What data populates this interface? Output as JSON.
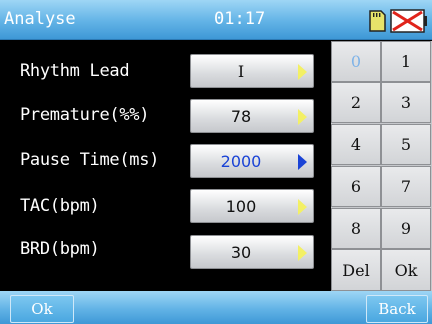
{
  "header": {
    "title": "Analyse",
    "time": "01:17",
    "icons": [
      "sd-card-icon",
      "battery-empty-icon"
    ]
  },
  "settings": [
    {
      "label": "Rhythm Lead",
      "value": "I",
      "active": false
    },
    {
      "label": "Premature(%%)",
      "value": "78",
      "active": false
    },
    {
      "label": "Pause Time(ms)",
      "value": "2000",
      "active": true
    },
    {
      "label": "TAC(bpm)",
      "value": "100",
      "active": false
    },
    {
      "label": "BRD(bpm)",
      "value": "30",
      "active": false
    }
  ],
  "keypad": {
    "keys": [
      "0",
      "1",
      "2",
      "3",
      "4",
      "5",
      "6",
      "7",
      "8",
      "9",
      "Del",
      "Ok"
    ]
  },
  "footer": {
    "ok_label": "Ok",
    "back_label": "Back"
  },
  "colors": {
    "header_blue": "#62b3e6",
    "active_value": "#1a43d6",
    "arrow_yellow": "#f3f065"
  }
}
